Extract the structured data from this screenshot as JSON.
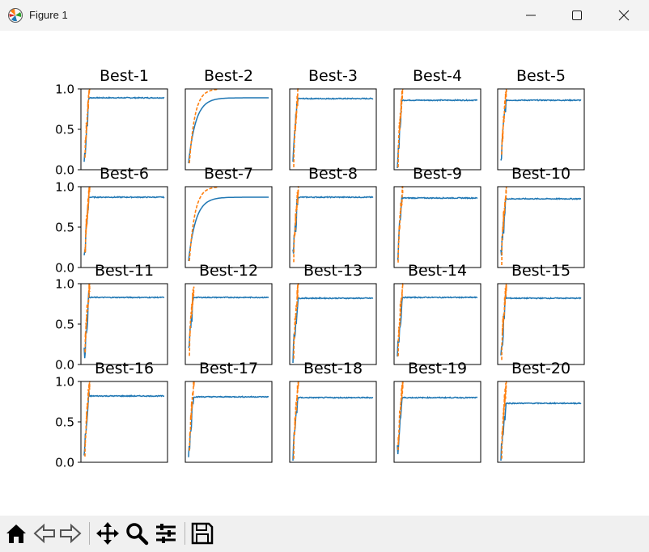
{
  "window": {
    "title": "Figure 1",
    "minimize_icon": "minimize-icon",
    "maximize_icon": "maximize-icon",
    "close_icon": "close-icon"
  },
  "colors": {
    "train_series": "#1f77b4",
    "test_series": "#ff7f0e"
  },
  "toolbar": {
    "icons": [
      "home-icon",
      "back-arrow-icon",
      "forward-arrow-icon",
      "pan-icon",
      "zoom-icon",
      "configure-subplots-icon",
      "save-icon"
    ]
  },
  "chart_data": {
    "type": "line",
    "layout": "4x5 grid of small multiples",
    "ylim": [
      0,
      1
    ],
    "yticks": [
      "0.0",
      "0.5",
      "1.0"
    ],
    "xticks_shown": false,
    "subplots": [
      {
        "title": "Best-1",
        "plateau": 0.89
      },
      {
        "title": "Best-2",
        "plateau": 0.89
      },
      {
        "title": "Best-3",
        "plateau": 0.88
      },
      {
        "title": "Best-4",
        "plateau": 0.86
      },
      {
        "title": "Best-5",
        "plateau": 0.86
      },
      {
        "title": "Best-6",
        "plateau": 0.87
      },
      {
        "title": "Best-7",
        "plateau": 0.87
      },
      {
        "title": "Best-8",
        "plateau": 0.87
      },
      {
        "title": "Best-9",
        "plateau": 0.86
      },
      {
        "title": "Best-10",
        "plateau": 0.85
      },
      {
        "title": "Best-11",
        "plateau": 0.83
      },
      {
        "title": "Best-12",
        "plateau": 0.83
      },
      {
        "title": "Best-13",
        "plateau": 0.82
      },
      {
        "title": "Best-14",
        "plateau": 0.83
      },
      {
        "title": "Best-15",
        "plateau": 0.82
      },
      {
        "title": "Best-16",
        "plateau": 0.82
      },
      {
        "title": "Best-17",
        "plateau": 0.81
      },
      {
        "title": "Best-18",
        "plateau": 0.8
      },
      {
        "title": "Best-19",
        "plateau": 0.8
      },
      {
        "title": "Best-20",
        "plateau": 0.73
      }
    ]
  }
}
